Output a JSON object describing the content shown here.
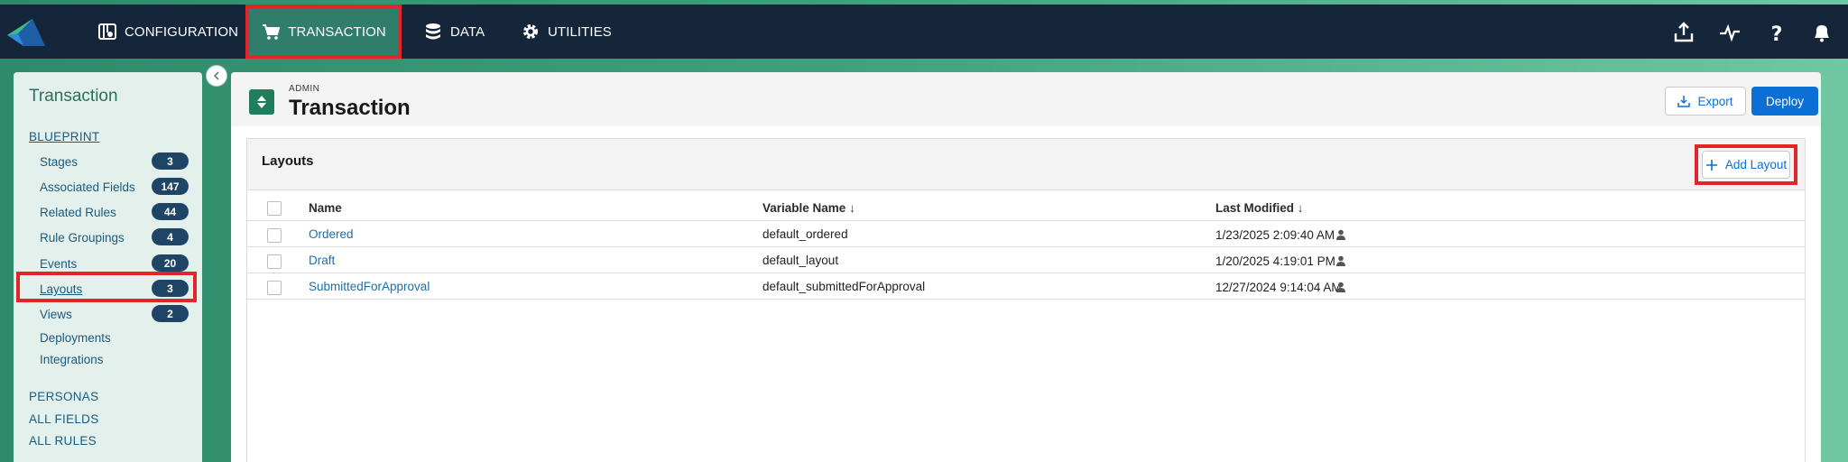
{
  "nav": {
    "items": [
      {
        "label": "CONFIGURATION",
        "icon": "config-icon"
      },
      {
        "label": "TRANSACTION",
        "icon": "cart-icon",
        "active": true
      },
      {
        "label": "DATA",
        "icon": "database-icon"
      },
      {
        "label": "UTILITIES",
        "icon": "gear-icon"
      }
    ],
    "right_icons": [
      "upload-icon",
      "activity-icon",
      "help-icon",
      "bell-icon"
    ]
  },
  "sidebar": {
    "title": "Transaction",
    "blueprint_label": "BLUEPRINT",
    "items": [
      {
        "label": "Stages",
        "count": "3"
      },
      {
        "label": "Associated Fields",
        "count": "147"
      },
      {
        "label": "Related Rules",
        "count": "44"
      },
      {
        "label": "Rule Groupings",
        "count": "4"
      },
      {
        "label": "Events",
        "count": "20"
      },
      {
        "label": "Layouts",
        "count": "3",
        "active": true
      },
      {
        "label": "Views",
        "count": "2"
      },
      {
        "label": "Deployments"
      },
      {
        "label": "Integrations"
      }
    ],
    "sections": [
      "PERSONAS",
      "ALL FIELDS",
      "ALL RULES"
    ]
  },
  "header": {
    "eyebrow": "ADMIN",
    "title": "Transaction",
    "export_label": "Export",
    "deploy_label": "Deploy"
  },
  "card": {
    "title": "Layouts",
    "add_label": "Add Layout",
    "columns": {
      "name": "Name",
      "variable": "Variable Name",
      "modified": "Last Modified"
    },
    "rows": [
      {
        "name": "Ordered",
        "variable": "default_ordered",
        "modified": "1/23/2025 2:09:40 AM"
      },
      {
        "name": "Draft",
        "variable": "default_layout",
        "modified": "1/20/2025 4:19:01 PM"
      },
      {
        "name": "SubmittedForApproval",
        "variable": "default_submittedForApproval",
        "modified": "12/27/2024 9:14:04 AM"
      }
    ]
  },
  "colors": {
    "nav_bg": "#16263a",
    "accent": "#0b6fd6",
    "highlight": "#e0252b",
    "badge": "#1f4566"
  }
}
